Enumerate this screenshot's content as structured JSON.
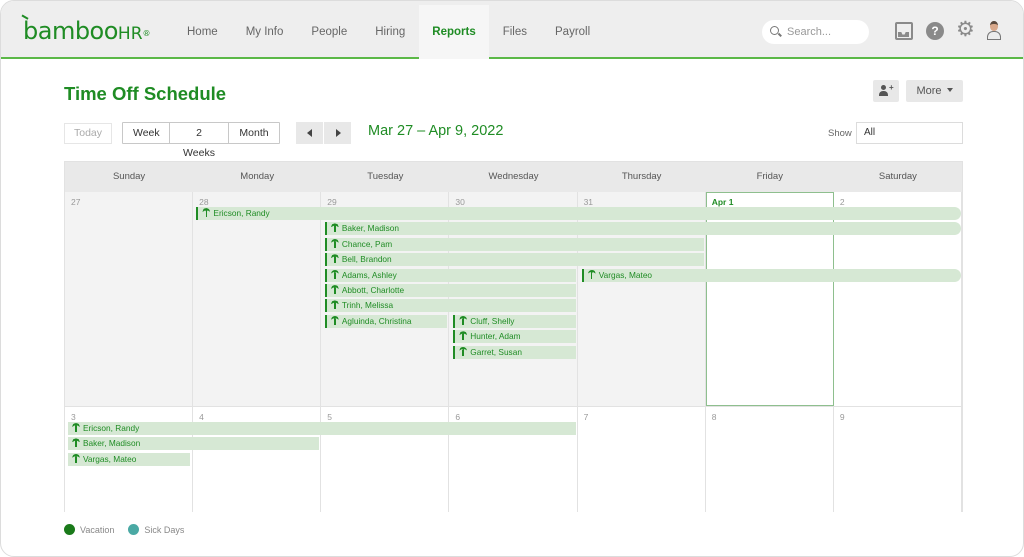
{
  "app": {
    "logo": {
      "text": "bamboo",
      "hr": "HR",
      "reg": "®"
    },
    "nav": [
      {
        "label": "Home",
        "active": false
      },
      {
        "label": "My Info",
        "active": false
      },
      {
        "label": "People",
        "active": false
      },
      {
        "label": "Hiring",
        "active": false
      },
      {
        "label": "Reports",
        "active": true
      },
      {
        "label": "Files",
        "active": false
      },
      {
        "label": "Payroll",
        "active": false
      }
    ],
    "search": {
      "placeholder": "Search..."
    },
    "icons": {
      "inbox": "inbox-icon",
      "help": "help-icon",
      "settings": "gear-icon",
      "avatar": "avatar"
    },
    "help_glyph": "?",
    "gear_glyph": "⚙"
  },
  "page": {
    "title": "Time Off Schedule",
    "more_label": "More",
    "toolbar": {
      "today_label": "Today",
      "views": [
        {
          "label": "Week",
          "active": false
        },
        {
          "label": "2 Weeks",
          "active": true
        },
        {
          "label": "Month",
          "active": false
        }
      ],
      "date_range": "Mar 27 – Apr 9, 2022",
      "show_label": "Show",
      "show_value": "All"
    }
  },
  "calendar": {
    "weekdays": [
      "Sunday",
      "Monday",
      "Tuesday",
      "Wednesday",
      "Thursday",
      "Friday",
      "Saturday"
    ],
    "weeks": [
      {
        "days": [
          {
            "num": "27",
            "state": "past"
          },
          {
            "num": "28",
            "state": "past"
          },
          {
            "num": "29",
            "state": "past"
          },
          {
            "num": "30",
            "state": "past"
          },
          {
            "num": "31",
            "state": "past"
          },
          {
            "num": "Apr 1",
            "state": "today"
          },
          {
            "num": "2",
            "state": "future"
          }
        ],
        "events": [
          {
            "name": "Ericson, Randy",
            "type": "vacation",
            "startCol": 1,
            "endCol": 6,
            "row": 0,
            "continues": true
          },
          {
            "name": "Baker, Madison",
            "type": "vacation",
            "startCol": 2,
            "endCol": 6,
            "row": 1,
            "continues": true
          },
          {
            "name": "Chance, Pam",
            "type": "vacation",
            "startCol": 2,
            "endCol": 4,
            "row": 2,
            "continues": false
          },
          {
            "name": "Bell, Brandon",
            "type": "vacation",
            "startCol": 2,
            "endCol": 4,
            "row": 3,
            "continues": false
          },
          {
            "name": "Adams, Ashley",
            "type": "vacation",
            "startCol": 2,
            "endCol": 3,
            "row": 4,
            "continues": false
          },
          {
            "name": "Vargas, Mateo",
            "type": "vacation",
            "startCol": 4,
            "endCol": 6,
            "row": 4,
            "continues": true
          },
          {
            "name": "Abbott, Charlotte",
            "type": "vacation",
            "startCol": 2,
            "endCol": 3,
            "row": 5,
            "continues": false
          },
          {
            "name": "Trinh, Melissa",
            "type": "vacation",
            "startCol": 2,
            "endCol": 3,
            "row": 6,
            "continues": false
          },
          {
            "name": "Agluinda, Christina",
            "type": "vacation",
            "startCol": 2,
            "endCol": 2,
            "row": 7,
            "continues": false
          },
          {
            "name": "Cluff, Shelly",
            "type": "vacation",
            "startCol": 3,
            "endCol": 3,
            "row": 7,
            "continues": false
          },
          {
            "name": "Hunter, Adam",
            "type": "vacation",
            "startCol": 3,
            "endCol": 3,
            "row": 8,
            "continues": false
          },
          {
            "name": "Garret, Susan",
            "type": "vacation",
            "startCol": 3,
            "endCol": 3,
            "row": 9,
            "continues": false
          }
        ]
      },
      {
        "days": [
          {
            "num": "3",
            "state": "future"
          },
          {
            "num": "4",
            "state": "future"
          },
          {
            "num": "5",
            "state": "future"
          },
          {
            "num": "6",
            "state": "future"
          },
          {
            "num": "7",
            "state": "future"
          },
          {
            "num": "8",
            "state": "future"
          },
          {
            "num": "9",
            "state": "future"
          }
        ],
        "events": [
          {
            "name": "Ericson, Randy",
            "type": "vacation",
            "startCol": 0,
            "endCol": 3,
            "row": 0,
            "continues": false,
            "continued": true
          },
          {
            "name": "Baker, Madison",
            "type": "vacation",
            "startCol": 0,
            "endCol": 1,
            "row": 1,
            "continues": false,
            "continued": true
          },
          {
            "name": "Vargas, Mateo",
            "type": "vacation",
            "startCol": 0,
            "endCol": 0,
            "row": 2,
            "continues": false,
            "continued": true
          }
        ]
      }
    ]
  },
  "legend": [
    {
      "label": "Vacation",
      "color": "#1a7a1a"
    },
    {
      "label": "Sick Days",
      "color": "#4aa9a4"
    }
  ]
}
